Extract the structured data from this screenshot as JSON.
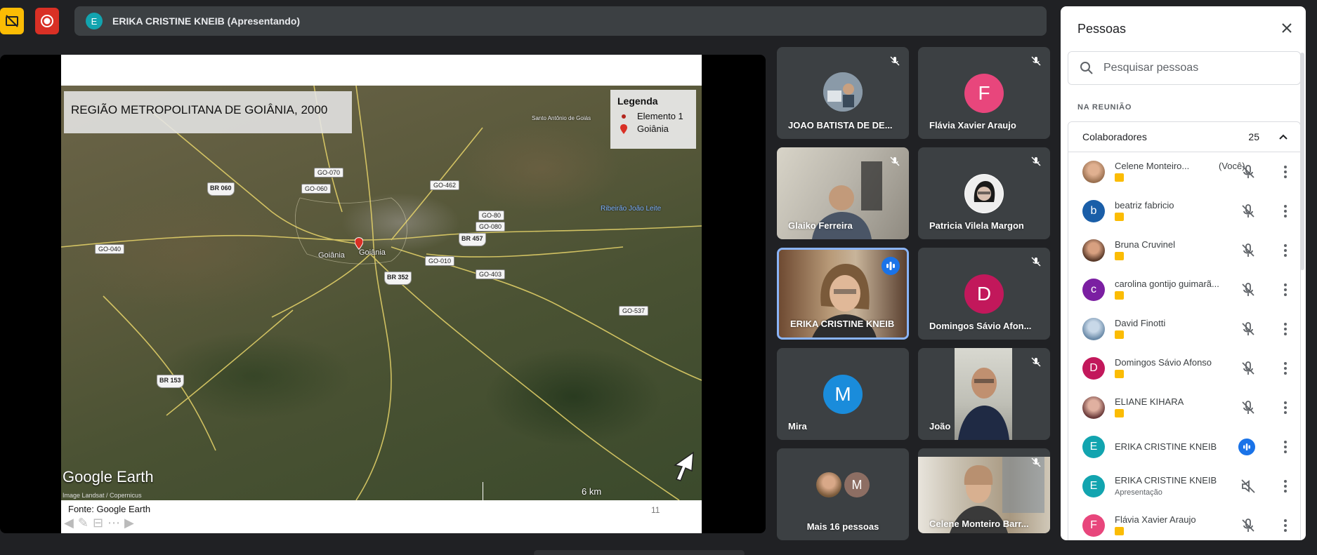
{
  "topbar": {
    "presenter_initial": "E",
    "presenter_title": "ERIKA CRISTINE KNEIB (Apresentando)",
    "colors": {
      "caption_button": "#fbbc04",
      "record_button": "#d93025"
    }
  },
  "slide": {
    "map_title": "REGIÃO METROPOLITANA DE GOIÂNIA, 2000",
    "legend": {
      "title": "Legenda",
      "items": [
        "Elemento 1",
        "Goiânia"
      ]
    },
    "road_shields": [
      "BR 060",
      "BR 457",
      "BR 352",
      "BR 153"
    ],
    "road_tags": [
      "GO-070",
      "GO-060",
      "GO-462",
      "GO-80",
      "GO-080",
      "GO-040",
      "GO-010",
      "GO-403",
      "GO-537"
    ],
    "places": [
      "Goiânia",
      "Goiânia",
      "Ribeirão João Leite",
      "Santo Antônio de Goiás"
    ],
    "logo": "Google Earth",
    "credit": "Image Landsat / Copernicus",
    "scale": "6 km",
    "source": "Fonte: Google Earth",
    "page_number": "11"
  },
  "tiles": [
    {
      "name": "JOAO BATISTA DE DE...",
      "kind": "photo",
      "muted": true
    },
    {
      "name": "Flávia Xavier Araujo",
      "initial": "F",
      "color": "#e8467c",
      "muted": true
    },
    {
      "name": "Glaiko Ferreira",
      "kind": "video",
      "muted": true
    },
    {
      "name": "Patricia Vilela Margon",
      "kind": "photo",
      "muted": true
    },
    {
      "name": "ERIKA CRISTINE KNEIB",
      "kind": "video",
      "speaking": true
    },
    {
      "name": "Domingos Sávio Afon...",
      "initial": "D",
      "color": "#c2185b",
      "muted": true
    },
    {
      "name": "Mira",
      "initial": "M",
      "color": "#1a8cdb",
      "muted": false
    },
    {
      "name": "João",
      "kind": "video",
      "muted": true
    },
    {
      "name": "Mais 16 pessoas",
      "kind": "more",
      "initial": "M"
    },
    {
      "name": "Celene Monteiro Barr...",
      "kind": "video",
      "muted": true
    }
  ],
  "panel": {
    "title": "Pessoas",
    "search_placeholder": "Pesquisar pessoas",
    "section": "NA REUNIÃO",
    "group": {
      "label": "Colaboradores",
      "count": "25"
    },
    "people": [
      {
        "name": "Celene Monteiro...",
        "you": "(Você)",
        "avatar": "photo",
        "tag": true,
        "state": "muted"
      },
      {
        "name": "beatriz fabricio",
        "initial": "b",
        "color": "#1a5ea8",
        "tag": true,
        "state": "muted"
      },
      {
        "name": "Bruna Cruvinel",
        "avatar": "photo",
        "tag": true,
        "state": "muted"
      },
      {
        "name": "carolina gontijo guimarã...",
        "initial": "c",
        "color": "#7b1fa2",
        "tag": true,
        "state": "muted"
      },
      {
        "name": "David Finotti",
        "avatar": "photo",
        "tag": true,
        "state": "muted"
      },
      {
        "name": "Domingos Sávio Afonso",
        "initial": "D",
        "color": "#c2185b",
        "tag": true,
        "state": "muted"
      },
      {
        "name": "ELIANE KIHARA",
        "avatar": "photo",
        "tag": true,
        "state": "muted"
      },
      {
        "name": "ERIKA CRISTINE KNEIB",
        "initial": "E",
        "color": "#12a4af",
        "tag": false,
        "state": "speaking"
      },
      {
        "name": "ERIKA CRISTINE KNEIB",
        "sub": "Apresentação",
        "initial": "E",
        "color": "#12a4af",
        "tag": false,
        "state": "presenting"
      },
      {
        "name": "Flávia Xavier Araujo",
        "initial": "F",
        "color": "#e8467c",
        "tag": true,
        "state": "muted"
      }
    ]
  }
}
